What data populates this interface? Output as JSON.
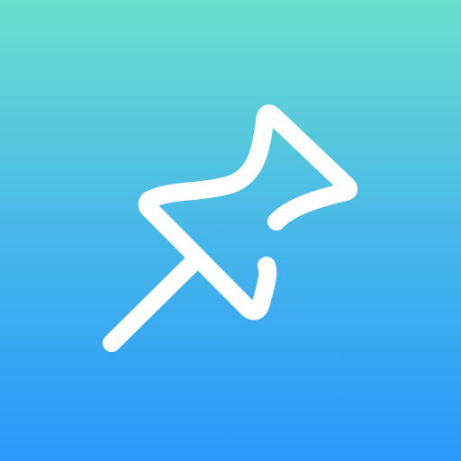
{
  "app_icon": {
    "icon": "pushpin-icon",
    "background_gradient": [
      "#68e0cc",
      "#4ab9e8",
      "#2898fb"
    ],
    "glyph_color": "#ffffff"
  }
}
